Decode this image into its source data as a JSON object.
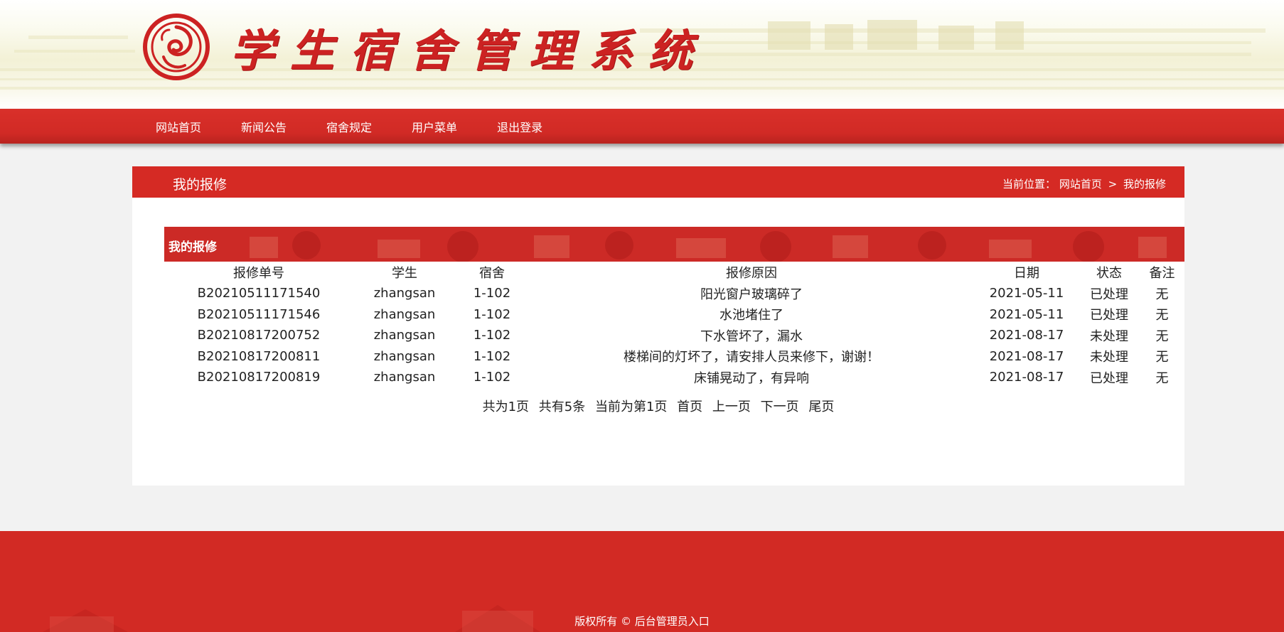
{
  "header": {
    "site_title": "学生宿舍管理系统"
  },
  "nav": {
    "items": [
      "网站首页",
      "新闻公告",
      "宿舍规定",
      "用户菜单",
      "退出登录"
    ]
  },
  "panel": {
    "title": "我的报修",
    "breadcrumb": {
      "prefix": "当前位置：",
      "home": "网站首页",
      "separator": ">",
      "current": "我的报修"
    },
    "section_label": "我的报修"
  },
  "table": {
    "headers": [
      "报修单号",
      "学生",
      "宿舍",
      "报修原因",
      "日期",
      "状态",
      "备注"
    ],
    "rows": [
      [
        "B20210511171540",
        "zhangsan",
        "1-102",
        "阳光窗户玻璃碎了",
        "2021-05-11",
        "已处理",
        "无"
      ],
      [
        "B20210511171546",
        "zhangsan",
        "1-102",
        "水池堵住了",
        "2021-05-11",
        "已处理",
        "无"
      ],
      [
        "B20210817200752",
        "zhangsan",
        "1-102",
        "下水管坏了，漏水",
        "2021-08-17",
        "未处理",
        "无"
      ],
      [
        "B20210817200811",
        "zhangsan",
        "1-102",
        "楼梯间的灯坏了，请安排人员来修下，谢谢！",
        "2021-08-17",
        "未处理",
        "无"
      ],
      [
        "B20210817200819",
        "zhangsan",
        "1-102",
        "床铺晃动了，有异响",
        "2021-08-17",
        "已处理",
        "无"
      ]
    ]
  },
  "pager": {
    "total_pages": "共为1页",
    "total_items": "共有5条",
    "current": "当前为第1页",
    "first": "首页",
    "prev": "上一页",
    "next": "下一页",
    "last": "尾页"
  },
  "footer": {
    "copyright": "版权所有 ©",
    "admin_link": "后台管理员入口"
  },
  "colors": {
    "brand_red": "#d52a24",
    "title_red": "#cc2222",
    "page_bg": "#f2f2f2"
  }
}
